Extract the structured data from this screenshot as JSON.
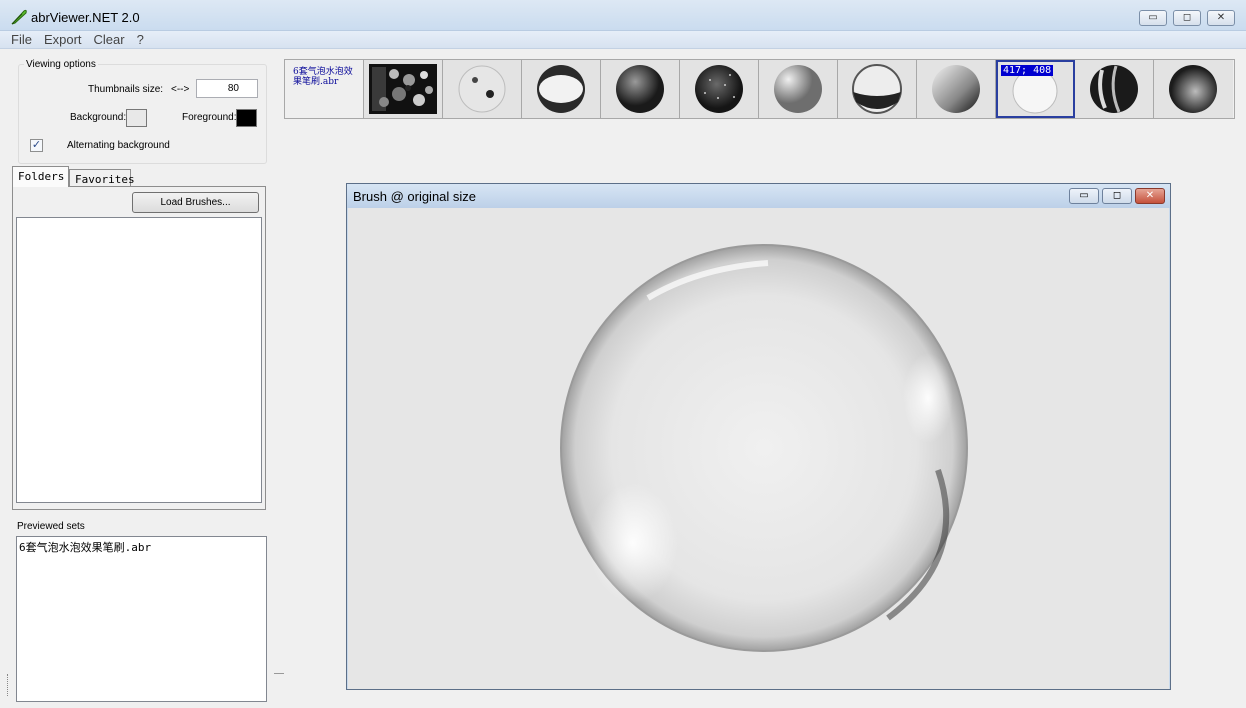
{
  "window": {
    "title": "abrViewer.NET 2.0",
    "controls": {
      "minimize": "▭",
      "maximize": "◻",
      "close": "✕"
    }
  },
  "menu": [
    "File",
    "Export",
    "Clear",
    "?"
  ],
  "viewing_options": {
    "legend": "Viewing options",
    "thumbnails_size_label": "Thumbnails size:",
    "arrows_label": "<-->",
    "thumbnails_size_value": "80",
    "background_label": "Background:",
    "foreground_label": "Foreground:",
    "background_color": "#e8e8e8",
    "foreground_color": "#000000",
    "alternating_background_label": "Alternating background",
    "alternating_background_checked": true
  },
  "tabs": {
    "folders": "Folders",
    "favorites": "Favorites",
    "load_brushes": "Load Brushes..."
  },
  "previewed_sets": {
    "label": "Previewed sets",
    "items": [
      "6套气泡水泡效果笔刷.abr"
    ]
  },
  "thumbnail_strip": {
    "set_name": "6套气泡水泡效果笔刷.abr",
    "selected_coord": "417; 408",
    "thumbnail_icons": [
      "brush-collage-icon",
      "eyes-sphere-icon",
      "shaded-bubble-icon",
      "dark-sphere-icon",
      "speckled-sphere-icon",
      "gradient-sphere-icon",
      "glass-bowl-icon",
      "swirl-sphere-icon",
      "clear-bubble-icon",
      "striped-sphere-icon",
      "dark-bubble-icon"
    ]
  },
  "preview_window": {
    "title": "Brush @ original size",
    "controls": {
      "minimize": "▭",
      "maximize": "◻",
      "close": "✕"
    }
  }
}
